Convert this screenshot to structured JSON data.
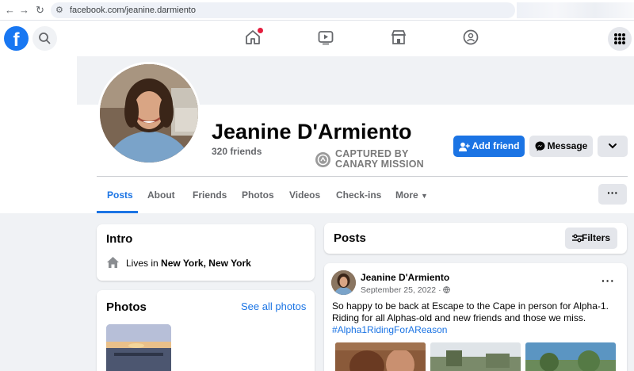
{
  "browser": {
    "url": "facebook.com/jeanine.darmiento"
  },
  "header": {
    "logo_letter": "f"
  },
  "profile": {
    "name": "Jeanine D'Armiento",
    "friends": "320 friends",
    "watermark_line1": "CAPTURED BY",
    "watermark_line2": "CANARY MISSION",
    "add_friend_label": "Add friend",
    "message_label": "Message"
  },
  "tabs": [
    {
      "label": "Posts",
      "active": true
    },
    {
      "label": "About"
    },
    {
      "label": "Friends"
    },
    {
      "label": "Photos"
    },
    {
      "label": "Videos"
    },
    {
      "label": "Check-ins"
    },
    {
      "label": "More"
    }
  ],
  "intro": {
    "title": "Intro",
    "lives_prefix": "Lives in ",
    "lives_place": "New York, New York"
  },
  "photos": {
    "title": "Photos",
    "see_all": "See all photos"
  },
  "posts": {
    "title": "Posts",
    "filters_label": "Filters"
  },
  "post": {
    "author": "Jeanine D'Armiento",
    "date": "September 25, 2022 · ",
    "text": "So happy to be back at Escape to the Cape in person for Alpha-1. Riding for all Alphas-old and new friends and those we miss.",
    "hashtag": "#Alpha1RidingForAReason"
  },
  "colors": {
    "brand": "#1877f2",
    "accent": "#1b74e4",
    "notification": "#e41e3f"
  },
  "icons": [
    "facebook-logo",
    "search-icon",
    "home-icon",
    "watch-icon",
    "marketplace-icon",
    "groups-icon",
    "menu-grid-icon",
    "add-friend-icon",
    "messenger-icon",
    "chevron-down-icon",
    "home-location-icon",
    "filters-icon",
    "globe-icon",
    "more-dots-icon"
  ]
}
